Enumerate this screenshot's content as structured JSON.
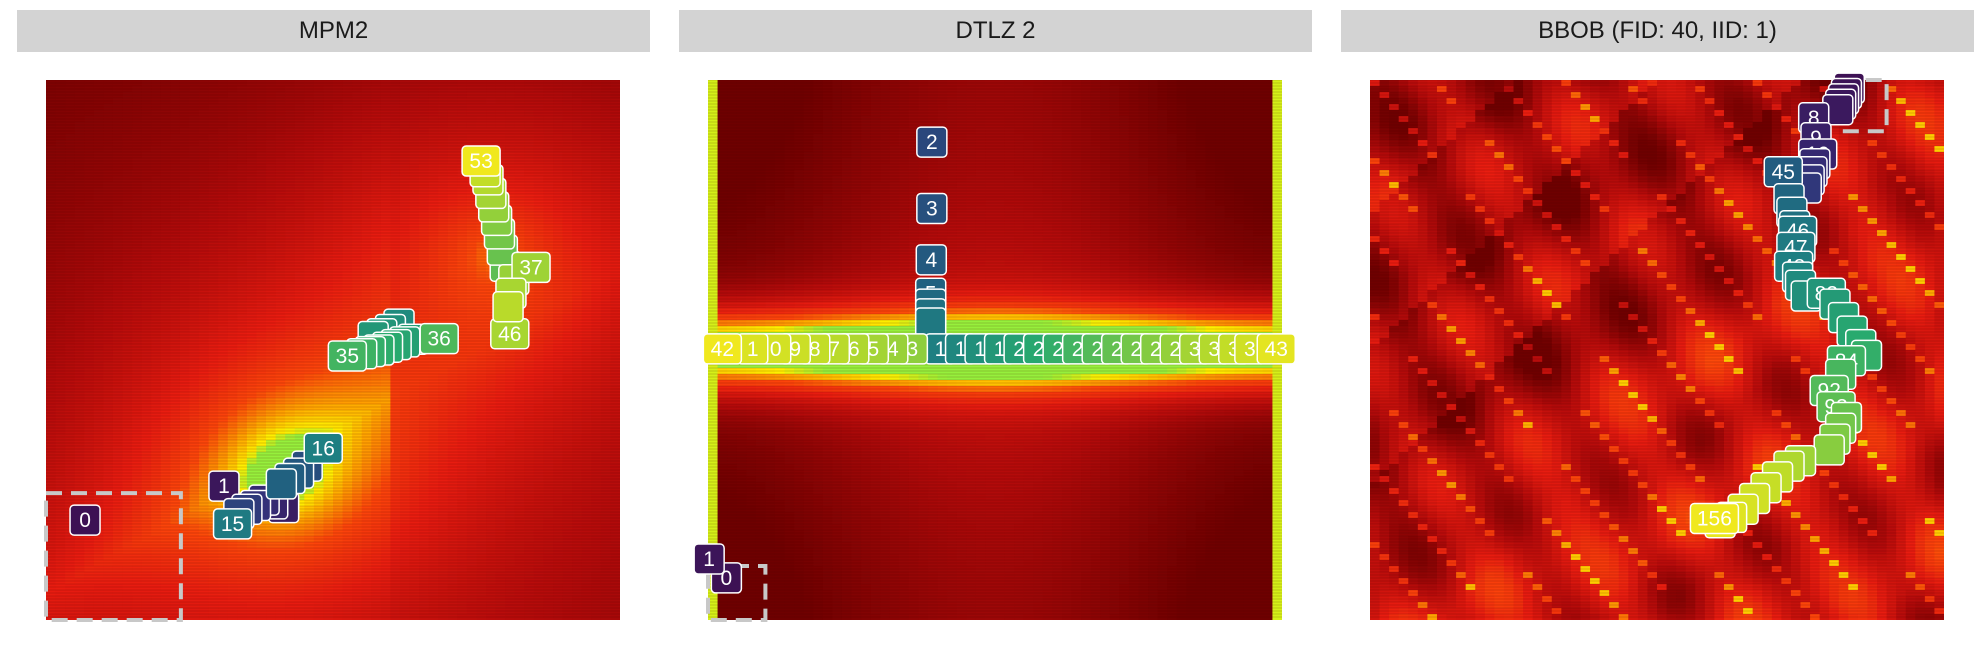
{
  "chart_data": [
    {
      "type": "heatmap",
      "title": "MPM2",
      "background": "mpm2",
      "xlim": [
        0,
        1
      ],
      "ylim": [
        0,
        1
      ],
      "start_box": {
        "x0": 0,
        "y0": 0,
        "x1": 0.235,
        "y1": 0.235
      },
      "points": [
        {
          "label": "0",
          "x": 0.068,
          "y": 0.185,
          "t": 0
        },
        {
          "label": "1",
          "x": 0.31,
          "y": 0.248,
          "t": 0.03
        },
        {
          "label": "2",
          "x": 0.414,
          "y": 0.208,
          "t": 0.06
        },
        {
          "label": "",
          "x": 0.395,
          "y": 0.215,
          "t": 0.1
        },
        {
          "label": "",
          "x": 0.38,
          "y": 0.222,
          "t": 0.13
        },
        {
          "label": "",
          "x": 0.365,
          "y": 0.212,
          "t": 0.16
        },
        {
          "label": "",
          "x": 0.35,
          "y": 0.205,
          "t": 0.19
        },
        {
          "label": "",
          "x": 0.336,
          "y": 0.197,
          "t": 0.22
        },
        {
          "label": "",
          "x": 0.455,
          "y": 0.285,
          "t": 0.25
        },
        {
          "label": "",
          "x": 0.44,
          "y": 0.272,
          "t": 0.28
        },
        {
          "label": "",
          "x": 0.425,
          "y": 0.262,
          "t": 0.3
        },
        {
          "label": "",
          "x": 0.41,
          "y": 0.252,
          "t": 0.32
        },
        {
          "label": "15",
          "x": 0.325,
          "y": 0.178,
          "t": 0.42
        },
        {
          "label": "16",
          "x": 0.483,
          "y": 0.318,
          "t": 0.44
        },
        {
          "label": "",
          "x": 0.615,
          "y": 0.548,
          "t": 0.48
        },
        {
          "label": "",
          "x": 0.6,
          "y": 0.538,
          "t": 0.5
        },
        {
          "label": "",
          "x": 0.585,
          "y": 0.53,
          "t": 0.52
        },
        {
          "label": "",
          "x": 0.57,
          "y": 0.525,
          "t": 0.53
        },
        {
          "label": "3",
          "x": 0.64,
          "y": 0.52,
          "t": 0.55
        },
        {
          "label": "",
          "x": 0.625,
          "y": 0.515,
          "t": 0.56
        },
        {
          "label": "",
          "x": 0.61,
          "y": 0.51,
          "t": 0.58
        },
        {
          "label": "",
          "x": 0.595,
          "y": 0.505,
          "t": 0.6
        },
        {
          "label": "",
          "x": 0.58,
          "y": 0.5,
          "t": 0.61
        },
        {
          "label": "",
          "x": 0.565,
          "y": 0.497,
          "t": 0.62
        },
        {
          "label": "",
          "x": 0.55,
          "y": 0.493,
          "t": 0.64
        },
        {
          "label": "36",
          "x": 0.685,
          "y": 0.521,
          "t": 0.67
        },
        {
          "label": "35",
          "x": 0.525,
          "y": 0.489,
          "t": 0.65
        },
        {
          "label": "",
          "x": 0.8,
          "y": 0.655,
          "t": 0.7
        },
        {
          "label": "",
          "x": 0.795,
          "y": 0.685,
          "t": 0.72
        },
        {
          "label": "",
          "x": 0.79,
          "y": 0.715,
          "t": 0.74
        },
        {
          "label": "",
          "x": 0.785,
          "y": 0.74,
          "t": 0.77
        },
        {
          "label": "",
          "x": 0.78,
          "y": 0.765,
          "t": 0.8
        },
        {
          "label": "",
          "x": 0.775,
          "y": 0.79,
          "t": 0.83
        },
        {
          "label": "",
          "x": 0.77,
          "y": 0.815,
          "t": 0.86
        },
        {
          "label": "",
          "x": 0.765,
          "y": 0.83,
          "t": 0.89
        },
        {
          "label": "",
          "x": 0.815,
          "y": 0.63,
          "t": 0.81
        },
        {
          "label": "",
          "x": 0.81,
          "y": 0.605,
          "t": 0.84
        },
        {
          "label": "",
          "x": 0.805,
          "y": 0.58,
          "t": 0.87
        },
        {
          "label": "37",
          "x": 0.845,
          "y": 0.653,
          "t": 0.82
        },
        {
          "label": "46",
          "x": 0.808,
          "y": 0.53,
          "t": 0.84
        },
        {
          "label": "53",
          "x": 0.758,
          "y": 0.85,
          "t": 1.0
        }
      ]
    },
    {
      "type": "heatmap",
      "title": "DTLZ 2",
      "background": "dtlz2",
      "xlim": [
        0,
        1
      ],
      "ylim": [
        0,
        1
      ],
      "start_box": {
        "x0": 0,
        "y0": 0,
        "x1": 0.1,
        "y1": 0.1
      },
      "points": [
        {
          "label": "0",
          "x": 0.032,
          "y": 0.078,
          "t": 0
        },
        {
          "label": "1",
          "x": 0.002,
          "y": 0.113,
          "t": 0.02
        },
        {
          "label": "2",
          "x": 0.39,
          "y": 0.885,
          "t": 0.23
        },
        {
          "label": "3",
          "x": 0.39,
          "y": 0.762,
          "t": 0.26
        },
        {
          "label": "4",
          "x": 0.389,
          "y": 0.667,
          "t": 0.29
        },
        {
          "label": "5",
          "x": 0.388,
          "y": 0.605,
          "t": 0.32
        },
        {
          "label": "",
          "x": 0.388,
          "y": 0.585,
          "t": 0.35
        },
        {
          "label": "",
          "x": 0.388,
          "y": 0.567,
          "t": 0.38
        },
        {
          "label": "",
          "x": 0.388,
          "y": 0.55,
          "t": 0.41
        },
        {
          "label": "42",
          "x": 0.025,
          "y": 0.502,
          "t": 1.0
        },
        {
          "label": "1",
          "x": 0.078,
          "y": 0.502,
          "t": 0.95
        },
        {
          "label": "0",
          "x": 0.118,
          "y": 0.502,
          "t": 0.93
        },
        {
          "label": "9",
          "x": 0.152,
          "y": 0.502,
          "t": 0.91
        },
        {
          "label": "8",
          "x": 0.186,
          "y": 0.502,
          "t": 0.89
        },
        {
          "label": "7",
          "x": 0.22,
          "y": 0.502,
          "t": 0.87
        },
        {
          "label": "6",
          "x": 0.254,
          "y": 0.502,
          "t": 0.85
        },
        {
          "label": "5",
          "x": 0.288,
          "y": 0.502,
          "t": 0.83
        },
        {
          "label": "4",
          "x": 0.322,
          "y": 0.502,
          "t": 0.81
        },
        {
          "label": "3",
          "x": 0.356,
          "y": 0.502,
          "t": 0.79
        },
        {
          "label": "1",
          "x": 0.405,
          "y": 0.502,
          "t": 0.44
        },
        {
          "label": "1",
          "x": 0.44,
          "y": 0.502,
          "t": 0.47
        },
        {
          "label": "1",
          "x": 0.474,
          "y": 0.502,
          "t": 0.5
        },
        {
          "label": "1",
          "x": 0.508,
          "y": 0.502,
          "t": 0.53
        },
        {
          "label": "2",
          "x": 0.542,
          "y": 0.502,
          "t": 0.56
        },
        {
          "label": "2",
          "x": 0.576,
          "y": 0.502,
          "t": 0.59
        },
        {
          "label": "2",
          "x": 0.61,
          "y": 0.502,
          "t": 0.62
        },
        {
          "label": "2",
          "x": 0.644,
          "y": 0.502,
          "t": 0.65
        },
        {
          "label": "2",
          "x": 0.678,
          "y": 0.502,
          "t": 0.68
        },
        {
          "label": "2",
          "x": 0.712,
          "y": 0.502,
          "t": 0.71
        },
        {
          "label": "2",
          "x": 0.746,
          "y": 0.502,
          "t": 0.74
        },
        {
          "label": "2",
          "x": 0.78,
          "y": 0.502,
          "t": 0.77
        },
        {
          "label": "2",
          "x": 0.814,
          "y": 0.502,
          "t": 0.8
        },
        {
          "label": "3",
          "x": 0.848,
          "y": 0.502,
          "t": 0.83
        },
        {
          "label": "3",
          "x": 0.882,
          "y": 0.502,
          "t": 0.86
        },
        {
          "label": "3",
          "x": 0.916,
          "y": 0.502,
          "t": 0.89
        },
        {
          "label": "3",
          "x": 0.944,
          "y": 0.502,
          "t": 0.92
        },
        {
          "label": "43",
          "x": 0.99,
          "y": 0.502,
          "t": 0.97
        }
      ]
    },
    {
      "type": "heatmap",
      "title": "BBOB (FID: 40, IID: 1)",
      "background": "bbob",
      "xlim": [
        0,
        1
      ],
      "ylim": [
        0,
        1
      ],
      "start_box": {
        "x0": 0.82,
        "y0": 0.905,
        "x1": 0.9,
        "y1": 1.0
      },
      "points": [
        {
          "label": "",
          "x": 0.835,
          "y": 0.985,
          "t": 0.0
        },
        {
          "label": "",
          "x": 0.83,
          "y": 0.975,
          "t": 0.01
        },
        {
          "label": "",
          "x": 0.825,
          "y": 0.965,
          "t": 0.02
        },
        {
          "label": "",
          "x": 0.82,
          "y": 0.955,
          "t": 0.03
        },
        {
          "label": "",
          "x": 0.815,
          "y": 0.945,
          "t": 0.04
        },
        {
          "label": "8",
          "x": 0.773,
          "y": 0.93,
          "t": 0.06
        },
        {
          "label": "9",
          "x": 0.777,
          "y": 0.893,
          "t": 0.08
        },
        {
          "label": "10",
          "x": 0.78,
          "y": 0.863,
          "t": 0.1
        },
        {
          "label": "",
          "x": 0.775,
          "y": 0.845,
          "t": 0.12
        },
        {
          "label": "",
          "x": 0.77,
          "y": 0.83,
          "t": 0.14
        },
        {
          "label": "",
          "x": 0.765,
          "y": 0.815,
          "t": 0.16
        },
        {
          "label": "",
          "x": 0.76,
          "y": 0.8,
          "t": 0.18
        },
        {
          "label": "45",
          "x": 0.72,
          "y": 0.83,
          "t": 0.3
        },
        {
          "label": "",
          "x": 0.73,
          "y": 0.78,
          "t": 0.33
        },
        {
          "label": "",
          "x": 0.735,
          "y": 0.755,
          "t": 0.36
        },
        {
          "label": "",
          "x": 0.74,
          "y": 0.73,
          "t": 0.38
        },
        {
          "label": "46",
          "x": 0.745,
          "y": 0.72,
          "t": 0.4
        },
        {
          "label": "47",
          "x": 0.742,
          "y": 0.69,
          "t": 0.42
        },
        {
          "label": "48",
          "x": 0.738,
          "y": 0.655,
          "t": 0.44
        },
        {
          "label": "",
          "x": 0.745,
          "y": 0.635,
          "t": 0.46
        },
        {
          "label": "",
          "x": 0.75,
          "y": 0.62,
          "t": 0.48
        },
        {
          "label": "",
          "x": 0.76,
          "y": 0.6,
          "t": 0.5
        },
        {
          "label": "83",
          "x": 0.795,
          "y": 0.605,
          "t": 0.52
        },
        {
          "label": "",
          "x": 0.81,
          "y": 0.585,
          "t": 0.54
        },
        {
          "label": "",
          "x": 0.825,
          "y": 0.56,
          "t": 0.56
        },
        {
          "label": "",
          "x": 0.84,
          "y": 0.535,
          "t": 0.58
        },
        {
          "label": "",
          "x": 0.855,
          "y": 0.51,
          "t": 0.6
        },
        {
          "label": "",
          "x": 0.865,
          "y": 0.49,
          "t": 0.62
        },
        {
          "label": "84",
          "x": 0.83,
          "y": 0.48,
          "t": 0.64
        },
        {
          "label": "",
          "x": 0.82,
          "y": 0.455,
          "t": 0.66
        },
        {
          "label": "92",
          "x": 0.8,
          "y": 0.425,
          "t": 0.68
        },
        {
          "label": "93",
          "x": 0.812,
          "y": 0.395,
          "t": 0.7
        },
        {
          "label": "",
          "x": 0.83,
          "y": 0.375,
          "t": 0.72
        },
        {
          "label": "",
          "x": 0.82,
          "y": 0.355,
          "t": 0.74
        },
        {
          "label": "",
          "x": 0.81,
          "y": 0.335,
          "t": 0.76
        },
        {
          "label": "",
          "x": 0.8,
          "y": 0.315,
          "t": 0.78
        },
        {
          "label": "",
          "x": 0.75,
          "y": 0.295,
          "t": 0.82
        },
        {
          "label": "",
          "x": 0.73,
          "y": 0.285,
          "t": 0.85
        },
        {
          "label": "",
          "x": 0.71,
          "y": 0.265,
          "t": 0.88
        },
        {
          "label": "",
          "x": 0.69,
          "y": 0.245,
          "t": 0.9
        },
        {
          "label": "",
          "x": 0.67,
          "y": 0.225,
          "t": 0.92
        },
        {
          "label": "",
          "x": 0.65,
          "y": 0.205,
          "t": 0.94
        },
        {
          "label": "",
          "x": 0.63,
          "y": 0.19,
          "t": 0.96
        },
        {
          "label": "",
          "x": 0.61,
          "y": 0.18,
          "t": 0.98
        },
        {
          "label": "156",
          "x": 0.6,
          "y": 0.188,
          "t": 1.0
        }
      ]
    }
  ]
}
